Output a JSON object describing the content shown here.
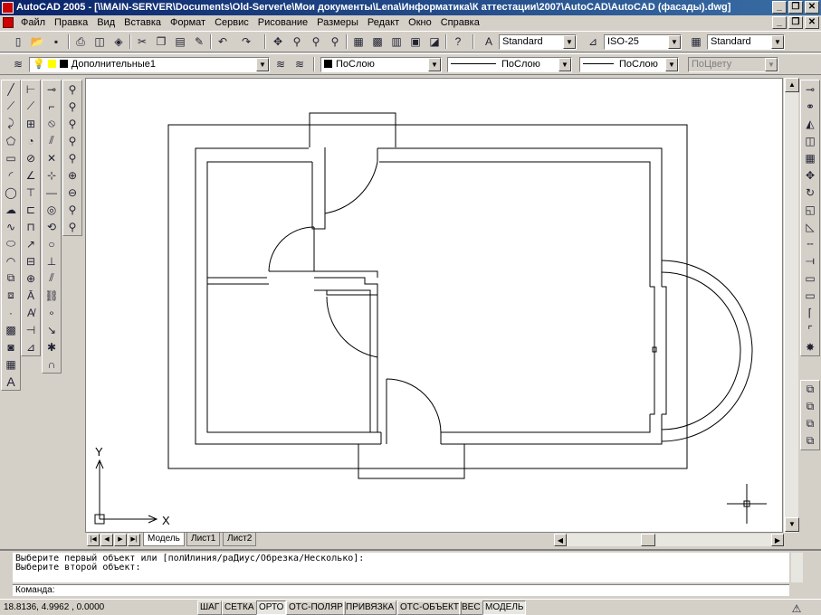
{
  "window": {
    "title": "AutoCAD 2005 - [\\\\MAIN-SERVER\\Documents\\Old-Server\\e\\Мои документы\\Lena\\Информатика\\К аттестации\\2007\\AutoCAD\\AutoCAD (фасады).dwg]",
    "minimize": "_",
    "restore": "❐",
    "close": "✕"
  },
  "menu": {
    "items": [
      "Файл",
      "Правка",
      "Вид",
      "Вставка",
      "Формат",
      "Сервис",
      "Рисование",
      "Размеры",
      "Редакт",
      "Окно",
      "Справка"
    ]
  },
  "standard_toolbar": {
    "text_style": "Standard",
    "dim_style": "ISO-25",
    "table_style": "Standard"
  },
  "layers_toolbar": {
    "layer": "Дополнительные1",
    "color": "ПоСлою",
    "linetype": "ПоСлою",
    "lineweight": "ПоСлою",
    "plot_style": "ПоЦвету"
  },
  "ucs": {
    "x_label": "X",
    "y_label": "Y"
  },
  "layout_tabs": {
    "tabs": [
      "Модель",
      "Лист1",
      "Лист2"
    ],
    "active": "Модель"
  },
  "command": {
    "line1": "Выберите первый объект или [полИлиния/раДиус/Обрезка/Несколько]:",
    "line2": "Выберите второй объект:",
    "prompt": "Команда:"
  },
  "status": {
    "coordinates": "18.8136, 4.9962 , 0.0000",
    "toggles": [
      {
        "label": "ШАГ",
        "on": false
      },
      {
        "label": "СЕТКА",
        "on": false
      },
      {
        "label": "ОРТО",
        "on": true
      },
      {
        "label": "ОТС-ПОЛЯР",
        "on": false
      },
      {
        "label": "ПРИВЯЗКА",
        "on": false
      },
      {
        "label": "ОТС-ОБЪЕКТ",
        "on": false
      },
      {
        "label": "ВЕС",
        "on": false
      },
      {
        "label": "МОДЕЛЬ",
        "on": true
      }
    ]
  }
}
